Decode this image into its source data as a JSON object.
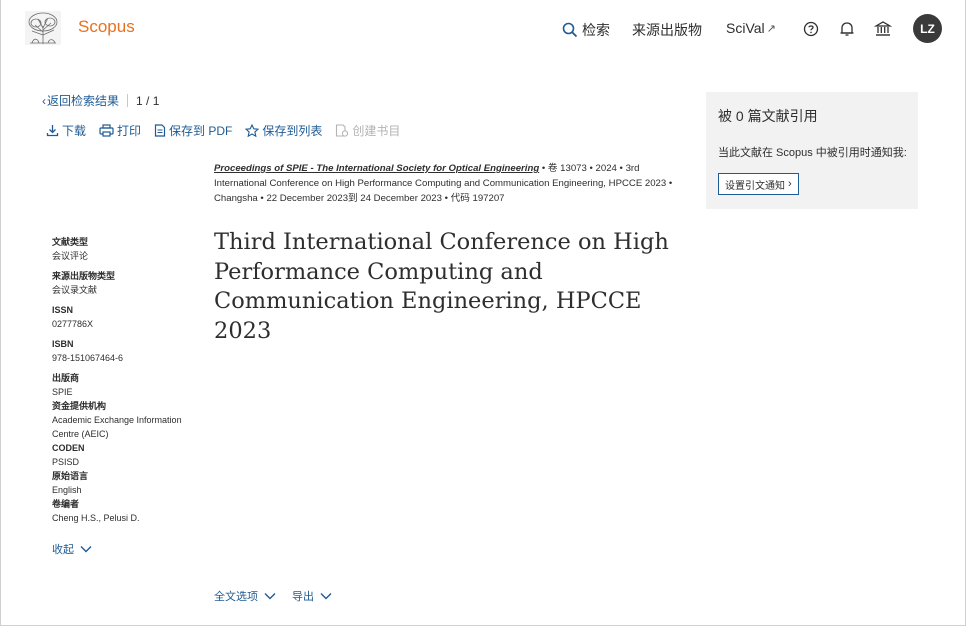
{
  "header": {
    "brand": "Scopus",
    "nav_search": "检索",
    "nav_sources": "来源出版物",
    "nav_scival": "SciVal",
    "nav_scival_ext": "↗",
    "avatar_initials": "LZ"
  },
  "breadcrumb": {
    "back_label": "返回检索结果",
    "pagination": "1 / 1"
  },
  "actions": {
    "download": "下载",
    "print": "打印",
    "save_pdf": "保存到 PDF",
    "save_list": "保存到列表",
    "create_bib": "创建书目"
  },
  "meta": {
    "source_title": "Proceedings of SPIE - The International Society for Optical Engineering",
    "volume": "卷 13073",
    "year": "2024",
    "conference": "3rd International Conference on High Performance Computing and Communication Engineering, HPCCE 2023",
    "location": "Changsha",
    "dates": "22 December 2023到 24 December 2023",
    "code": "代码 197207",
    "bullet": "•"
  },
  "document_title": "Third International Conference on High Performance Computing and Communication Engineering, HPCCE 2023",
  "details": {
    "doc_type_label": "文献类型",
    "doc_type_value": "会议评论",
    "source_type_label": "来源出版物类型",
    "source_type_value": "会议录文献",
    "issn_label": "ISSN",
    "issn_value": "0277786X",
    "isbn_label": "ISBN",
    "isbn_value": "978-151067464-6",
    "publisher_label": "出版商",
    "publisher_value": "SPIE",
    "funder_label": "资金提供机构",
    "funder_value": "Academic Exchange Information Centre (AEIC)",
    "coden_label": "CODEN",
    "coden_value": "PSISD",
    "language_label": "原始语言",
    "language_value": "English",
    "editors_label": "卷编者",
    "editors_value": "Cheng H.S., Pelusi D.",
    "collapse_label": "收起"
  },
  "cited_panel": {
    "title": "被 0 篇文献引用",
    "notify_text": "当此文献在 Scopus 中被引用时通知我:",
    "button_label": "设置引文通知",
    "button_chevron": "›"
  },
  "bottom": {
    "full_text": "全文选项",
    "export": "导出"
  },
  "colors": {
    "brand_orange": "#e9711c",
    "link_blue": "#1f5b94",
    "panel_bg": "#f2f2f2",
    "avatar_bg": "#3a3a3a"
  }
}
